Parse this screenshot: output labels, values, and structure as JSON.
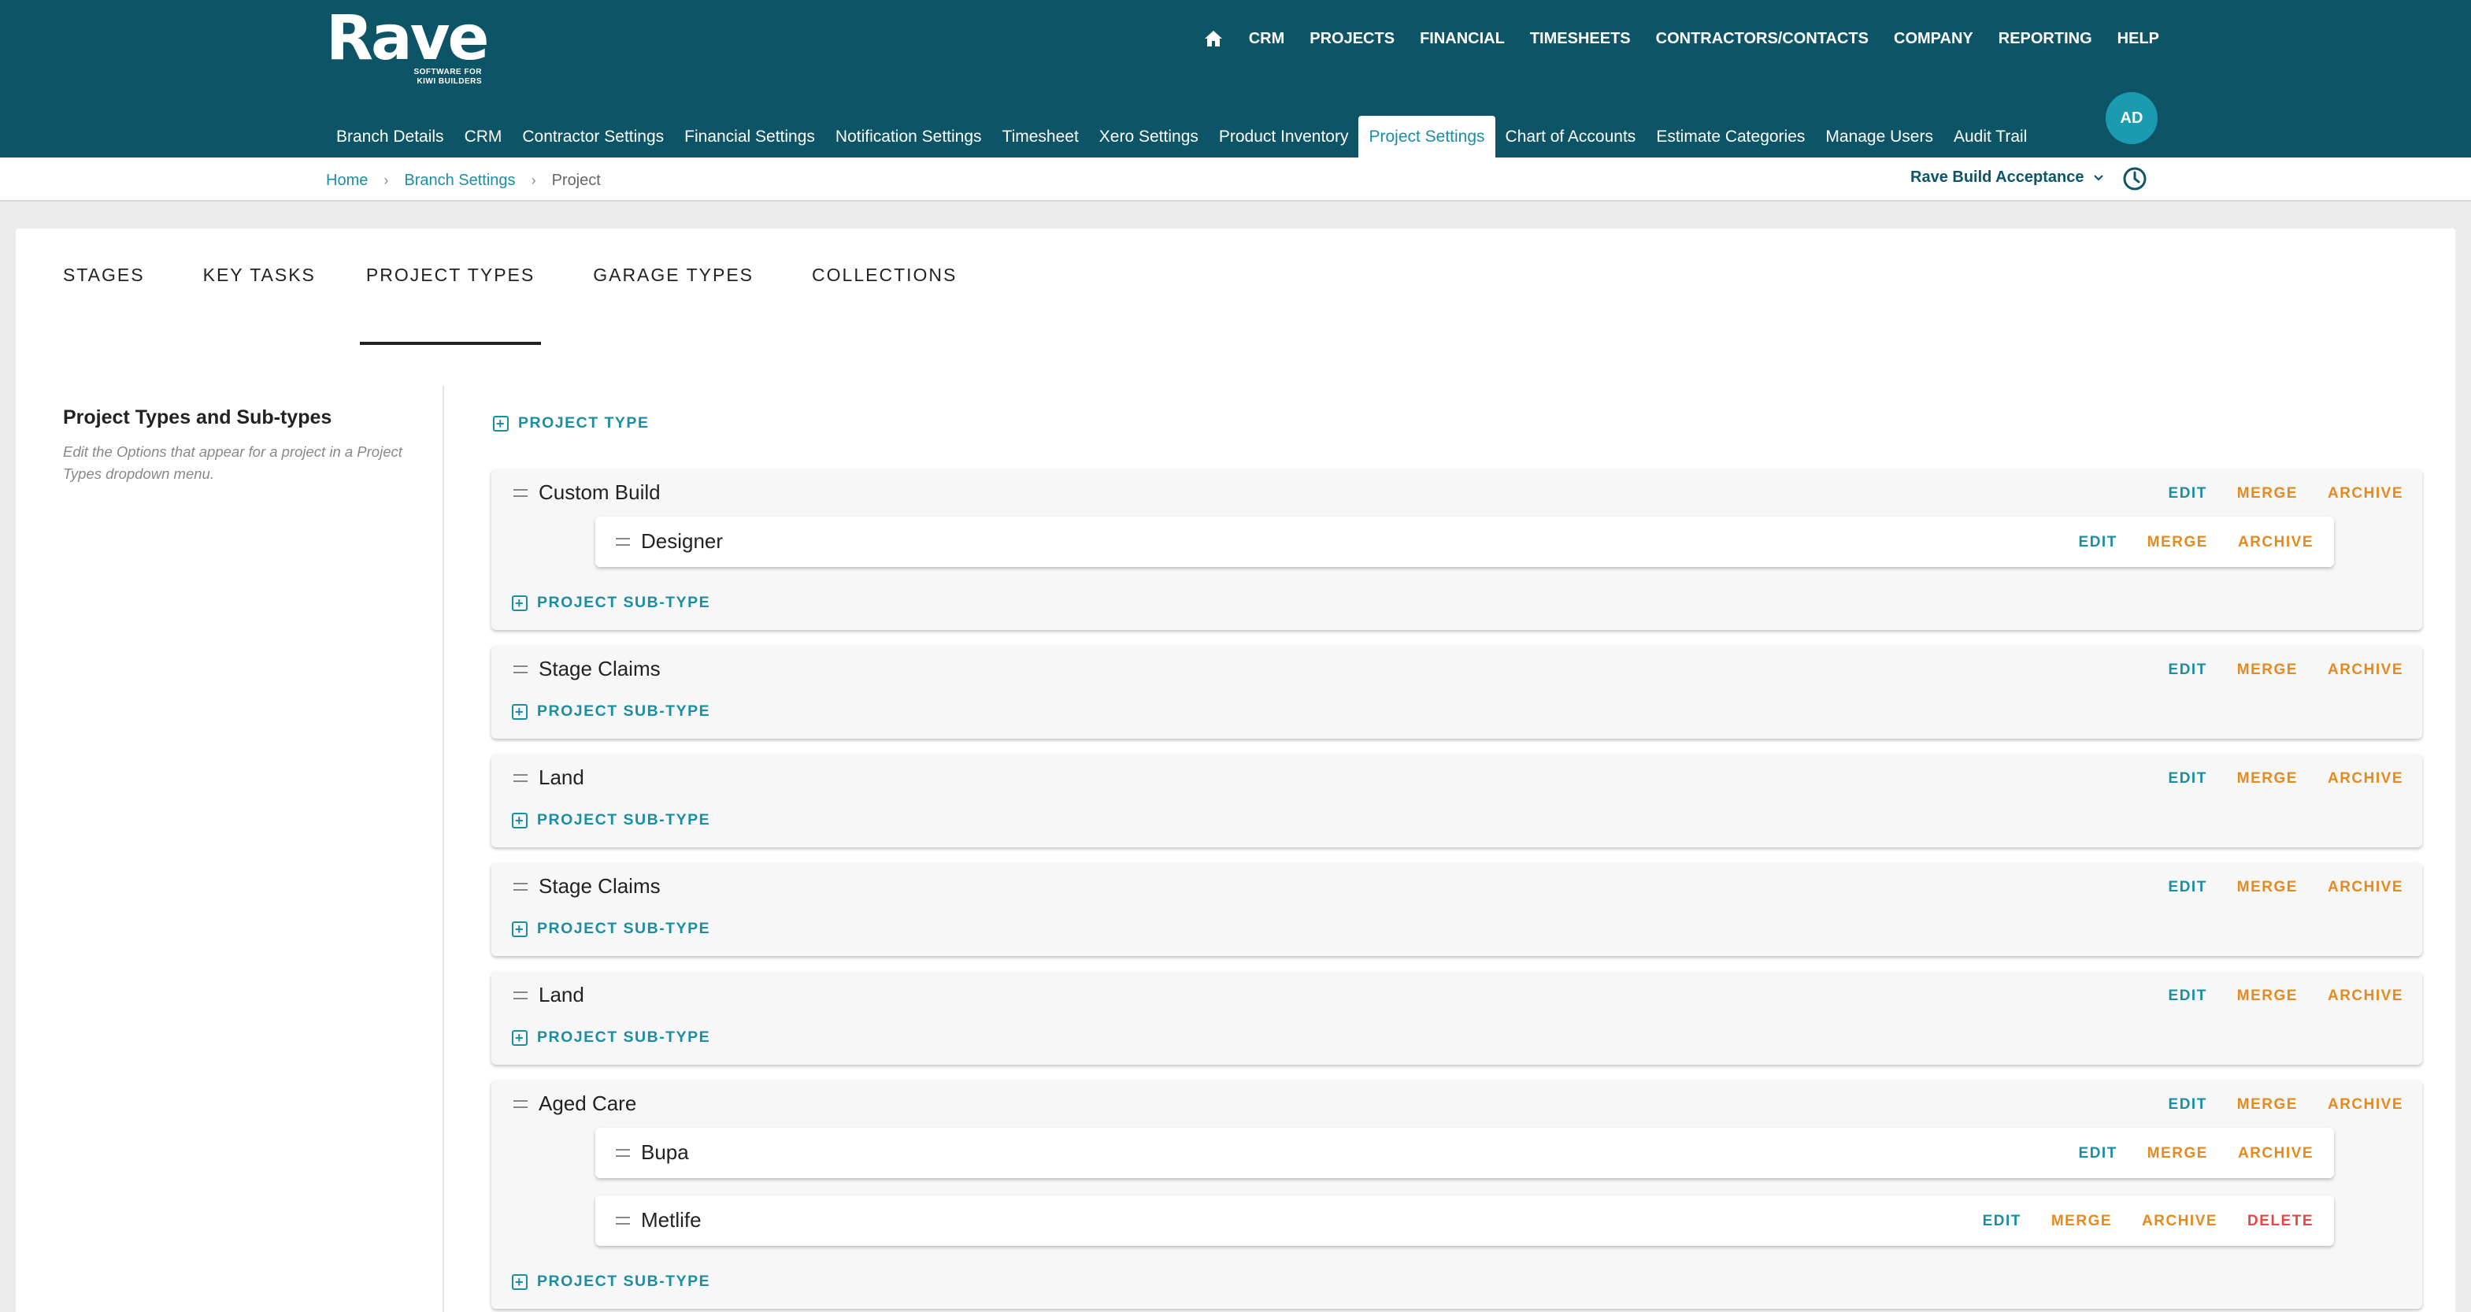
{
  "header": {
    "logo_word": "Rave",
    "logo_tagline_1": "SOFTWARE FOR",
    "logo_tagline_2": "KIWI BUILDERS",
    "top_nav": [
      "CRM",
      "PROJECTS",
      "FINANCIAL",
      "TIMESHEETS",
      "CONTRACTORS/CONTACTS",
      "COMPANY",
      "REPORTING",
      "HELP"
    ],
    "sub_nav": [
      "Branch Details",
      "CRM",
      "Contractor Settings",
      "Financial Settings",
      "Notification Settings",
      "Timesheet",
      "Xero Settings",
      "Product Inventory",
      "Project Settings",
      "Chart of Accounts",
      "Estimate Categories",
      "Manage Users",
      "Audit Trail"
    ],
    "sub_nav_active": "Project Settings",
    "avatar_initials": "AD"
  },
  "breadcrumb": {
    "items": [
      "Home",
      "Branch Settings",
      "Project"
    ],
    "branch_selector": "Rave Build Acceptance"
  },
  "tabs": {
    "items": [
      "STAGES",
      "KEY TASKS",
      "PROJECT TYPES",
      "GARAGE TYPES",
      "COLLECTIONS"
    ],
    "active": "PROJECT TYPES"
  },
  "sidebar": {
    "title": "Project Types and Sub-types",
    "description": "Edit the Options that appear for a project in a Project Types dropdown menu."
  },
  "actions": {
    "add_project_type": "PROJECT TYPE",
    "add_project_subtype": "PROJECT SUB-TYPE",
    "edit": "EDIT",
    "merge": "MERGE",
    "archive": "ARCHIVE",
    "delete": "DELETE"
  },
  "project_types": [
    {
      "name": "Custom Build",
      "subtypes": [
        {
          "name": "Designer",
          "deletable": false
        }
      ]
    },
    {
      "name": "Stage Claims",
      "subtypes": []
    },
    {
      "name": "Land",
      "subtypes": []
    },
    {
      "name": "Stage Claims",
      "subtypes": []
    },
    {
      "name": "Land",
      "subtypes": []
    },
    {
      "name": "Aged Care",
      "subtypes": [
        {
          "name": "Bupa",
          "deletable": false
        },
        {
          "name": "Metlife",
          "deletable": true
        }
      ]
    }
  ],
  "colors": {
    "header_bg": "#0d5566",
    "accent_teal": "#1a8ea3",
    "accent_orange": "#e68a1e",
    "danger_red": "#e64646"
  }
}
